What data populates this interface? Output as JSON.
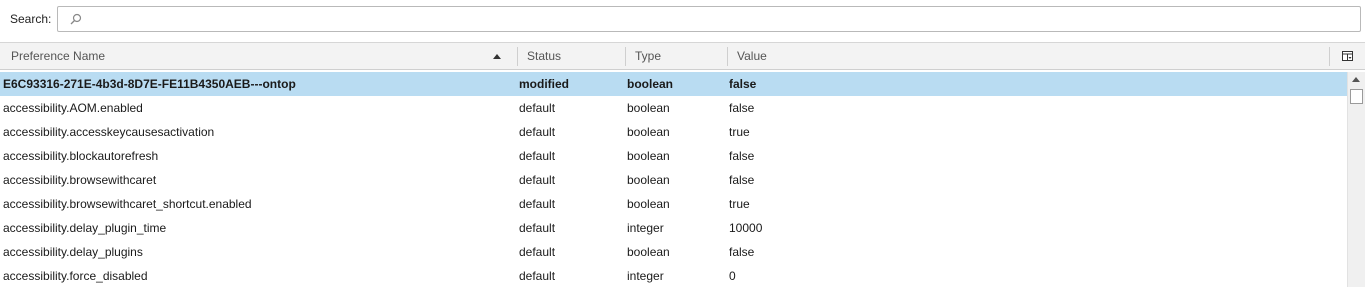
{
  "search": {
    "label": "Search:",
    "placeholder": "",
    "value": ""
  },
  "columns": {
    "name": "Preference Name",
    "status": "Status",
    "type": "Type",
    "value": "Value"
  },
  "sort": {
    "column": "Preference Name",
    "direction": "ascending"
  },
  "rows": [
    {
      "name": "E6C93316-271E-4b3d-8D7E-FE11B4350AEB---ontop",
      "status": "modified",
      "type": "boolean",
      "value": "false",
      "selected": true
    },
    {
      "name": "accessibility.AOM.enabled",
      "status": "default",
      "type": "boolean",
      "value": "false"
    },
    {
      "name": "accessibility.accesskeycausesactivation",
      "status": "default",
      "type": "boolean",
      "value": "true"
    },
    {
      "name": "accessibility.blockautorefresh",
      "status": "default",
      "type": "boolean",
      "value": "false"
    },
    {
      "name": "accessibility.browsewithcaret",
      "status": "default",
      "type": "boolean",
      "value": "false"
    },
    {
      "name": "accessibility.browsewithcaret_shortcut.enabled",
      "status": "default",
      "type": "boolean",
      "value": "true"
    },
    {
      "name": "accessibility.delay_plugin_time",
      "status": "default",
      "type": "integer",
      "value": "10000"
    },
    {
      "name": "accessibility.delay_plugins",
      "status": "default",
      "type": "boolean",
      "value": "false"
    },
    {
      "name": "accessibility.force_disabled",
      "status": "default",
      "type": "integer",
      "value": "0"
    }
  ],
  "colors": {
    "selected_row": "#b9dcf2",
    "header_bg": "#f3f3f3"
  }
}
